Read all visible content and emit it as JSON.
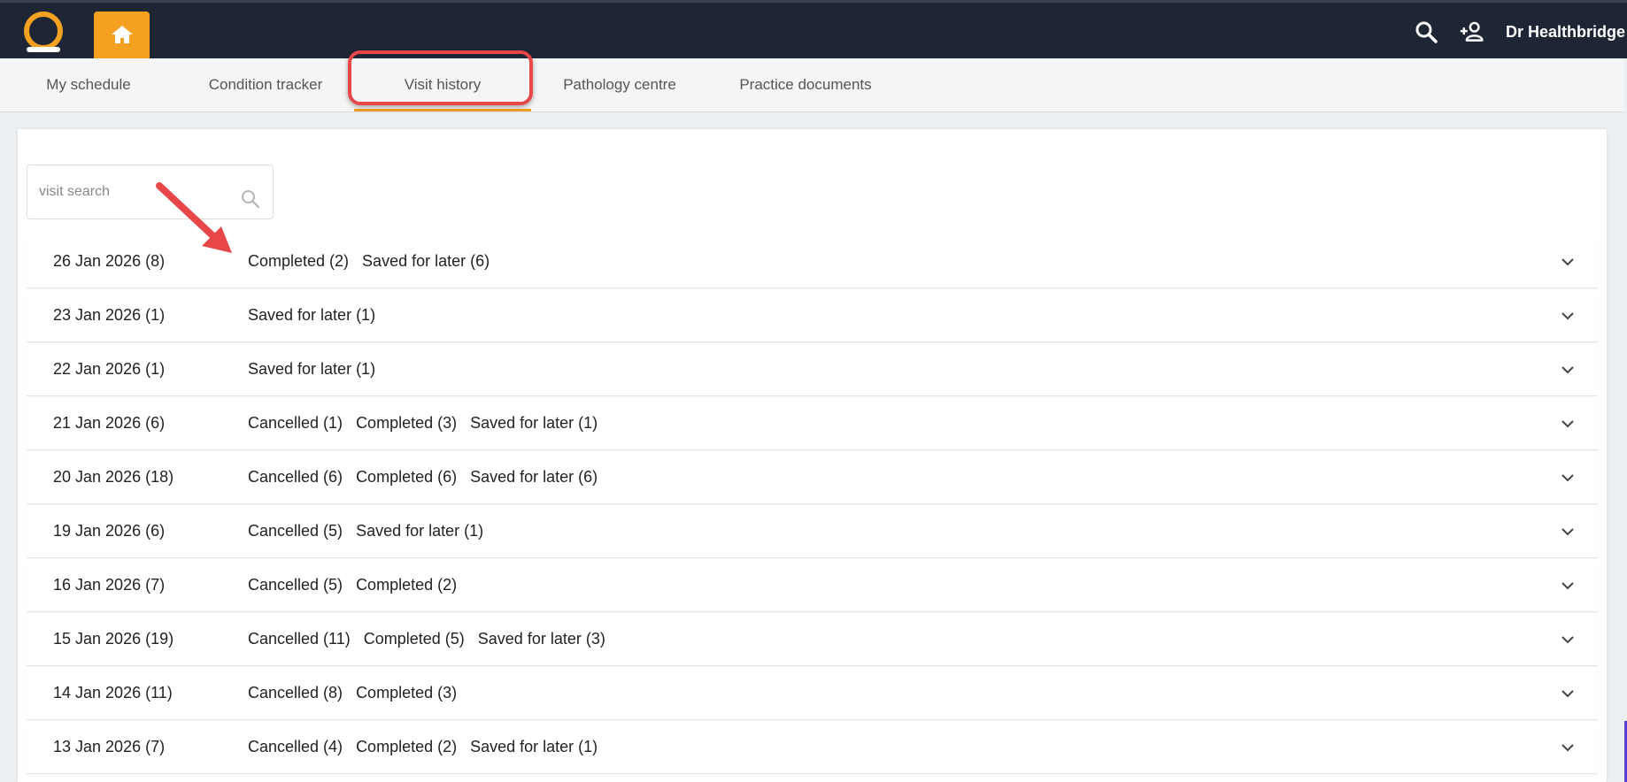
{
  "header": {
    "user_name": "Dr Healthbridge",
    "icons": [
      "logo-icon",
      "home-icon",
      "search-icon",
      "add-person-icon"
    ],
    "accent_color": "#f4a121",
    "bar_color": "#1e2535"
  },
  "tabs": [
    {
      "label": "My schedule"
    },
    {
      "label": "Condition tracker"
    },
    {
      "label": "Visit history",
      "active": true
    },
    {
      "label": "Pathology centre"
    },
    {
      "label": "Practice documents"
    }
  ],
  "search": {
    "placeholder": "visit search",
    "value": ""
  },
  "visits": [
    {
      "date": "26 Jan 2026 (8)",
      "statuses": [
        "Completed (2)",
        "Saved for later (6)"
      ]
    },
    {
      "date": "23 Jan 2026 (1)",
      "statuses": [
        "Saved for later (1)"
      ]
    },
    {
      "date": "22 Jan 2026 (1)",
      "statuses": [
        "Saved for later (1)"
      ]
    },
    {
      "date": "21 Jan 2026 (6)",
      "statuses": [
        "Cancelled (1)",
        "Completed (3)",
        "Saved for later (1)"
      ]
    },
    {
      "date": "20 Jan 2026 (18)",
      "statuses": [
        "Cancelled (6)",
        "Completed (6)",
        "Saved for later (6)"
      ]
    },
    {
      "date": "19 Jan 2026 (6)",
      "statuses": [
        "Cancelled (5)",
        "Saved for later (1)"
      ]
    },
    {
      "date": "16 Jan 2026 (7)",
      "statuses": [
        "Cancelled (5)",
        "Completed (2)"
      ]
    },
    {
      "date": "15 Jan 2026 (19)",
      "statuses": [
        "Cancelled (11)",
        "Completed (5)",
        "Saved for later (3)"
      ]
    },
    {
      "date": "14 Jan 2026 (11)",
      "statuses": [
        "Cancelled (8)",
        "Completed (3)"
      ]
    },
    {
      "date": "13 Jan 2026 (7)",
      "statuses": [
        "Cancelled (4)",
        "Completed (2)",
        "Saved for later (1)"
      ]
    }
  ],
  "annotation": {
    "highlight_color": "#e8474a"
  }
}
